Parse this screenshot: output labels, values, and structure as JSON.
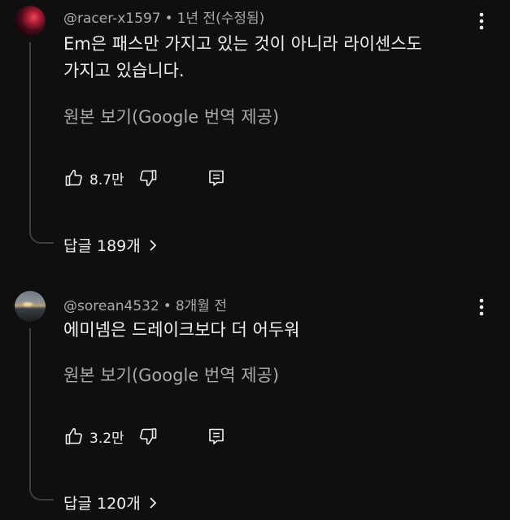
{
  "comments": [
    {
      "author": "@racer-x1597",
      "separator": "•",
      "time": "1년 전(수정됨)",
      "text_line1": "Em은 패스만 가지고 있는 것이 아니라 라이센스도",
      "text_line2": "가지고 있습니다.",
      "translate_label": "원본 보기(Google 번역 제공)",
      "likes": "8.7만",
      "replies_label": "답글 189개",
      "avatar_icon": "red-abstract-avatar"
    },
    {
      "author": "@sorean4532",
      "separator": "•",
      "time": "8개월 전",
      "text_line1": "에미넴은 드레이크보다 더 어두워",
      "translate_label": "원본 보기(Google 번역 제공)",
      "likes": "3.2만",
      "replies_label": "답글 120개",
      "avatar_icon": "sunset-landscape-avatar"
    }
  ],
  "icons": {
    "like": "thumbs-up-icon",
    "dislike": "thumbs-down-icon",
    "reply": "reply-comment-icon",
    "more": "more-vertical-icon",
    "chevron": "chevron-right-icon"
  },
  "colors": {
    "background": "#0f0f0f",
    "primary_text": "#f1f1f1",
    "secondary_text": "#aaaaaa",
    "thread_line": "#3d3d3d"
  }
}
